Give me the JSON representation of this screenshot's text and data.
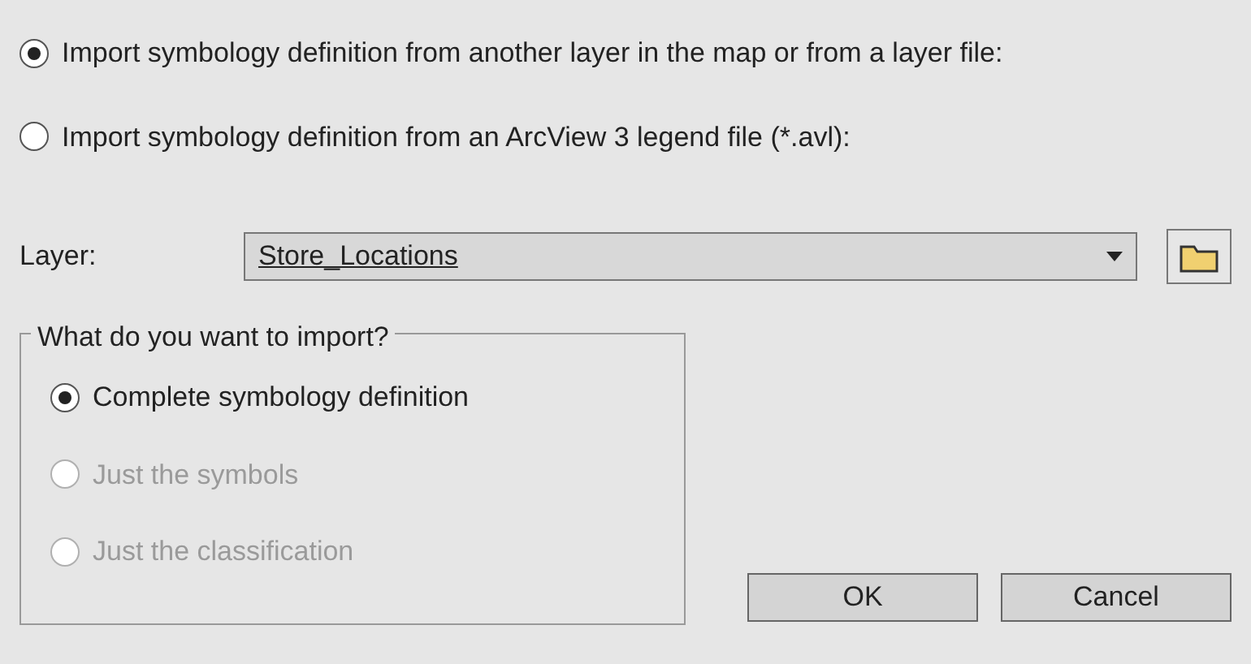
{
  "source_options": [
    {
      "label": "Import symbology definition from another layer in the map or from a layer file:",
      "selected": true
    },
    {
      "label": "Import symbology definition from an ArcView 3 legend file (*.avl):",
      "selected": false
    }
  ],
  "layer": {
    "label": "Layer:",
    "value": "Store_Locations"
  },
  "import_group": {
    "title": "What do you want to import?",
    "options": [
      {
        "label": "Complete symbology definition",
        "selected": true,
        "disabled": false
      },
      {
        "label": "Just the symbols",
        "selected": false,
        "disabled": true
      },
      {
        "label": "Just the classification",
        "selected": false,
        "disabled": true
      }
    ]
  },
  "buttons": [
    "OK",
    "Cancel"
  ]
}
